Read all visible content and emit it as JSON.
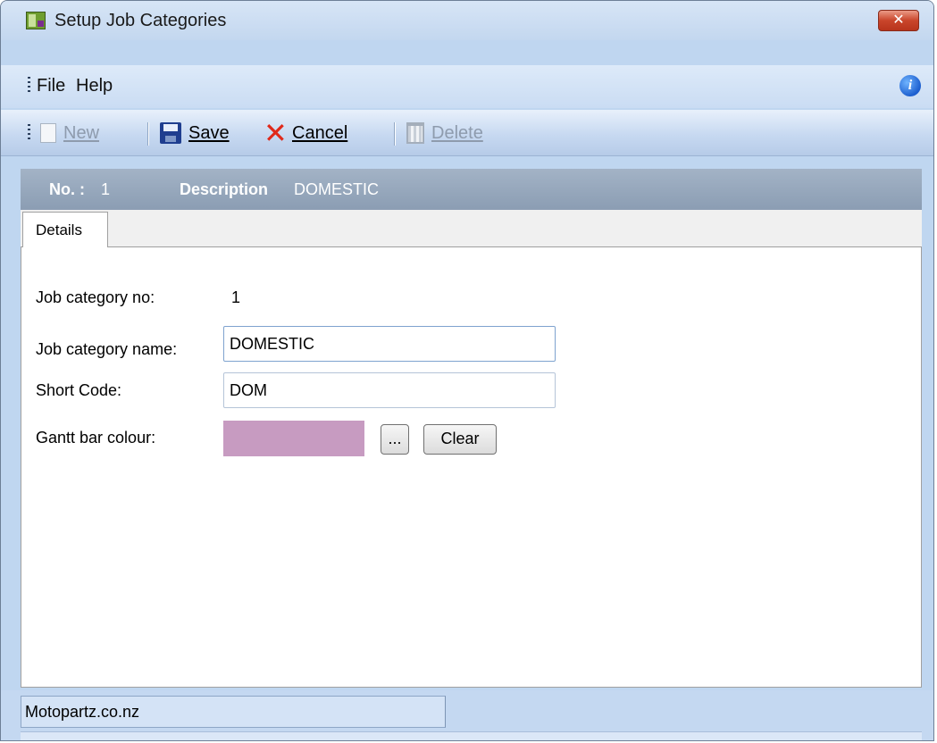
{
  "window": {
    "title": "Setup Job Categories",
    "close_glyph": "✕"
  },
  "menu": {
    "items": [
      {
        "label": "File"
      },
      {
        "label": "Help"
      }
    ],
    "info_glyph": "i"
  },
  "toolbar": {
    "new_label": "New",
    "save_label": "Save",
    "cancel_label": "Cancel",
    "delete_label": "Delete",
    "cancel_glyph": "✕"
  },
  "header": {
    "no_label": "No. :",
    "no_value": "1",
    "description_label": "Description",
    "description_value": "DOMESTIC"
  },
  "tabs": [
    {
      "label": "Details",
      "active": true
    }
  ],
  "form": {
    "category_no_label": "Job category no:",
    "category_no_value": "1",
    "category_name_label": "Job category name:",
    "category_name_value": "DOMESTIC",
    "short_code_label": "Short Code:",
    "short_code_value": "DOM",
    "gantt_colour_label": "Gantt bar colour:",
    "gantt_colour_value": "#c79bc1",
    "browse_label": "...",
    "clear_label": "Clear"
  },
  "status": {
    "text": "Motopartz.co.nz"
  },
  "icons": {
    "app": "app-window-icon",
    "new": "new-document-icon",
    "save": "floppy-disk-icon",
    "cancel": "red-x-icon",
    "delete": "trash-can-icon",
    "info": "info-icon"
  }
}
